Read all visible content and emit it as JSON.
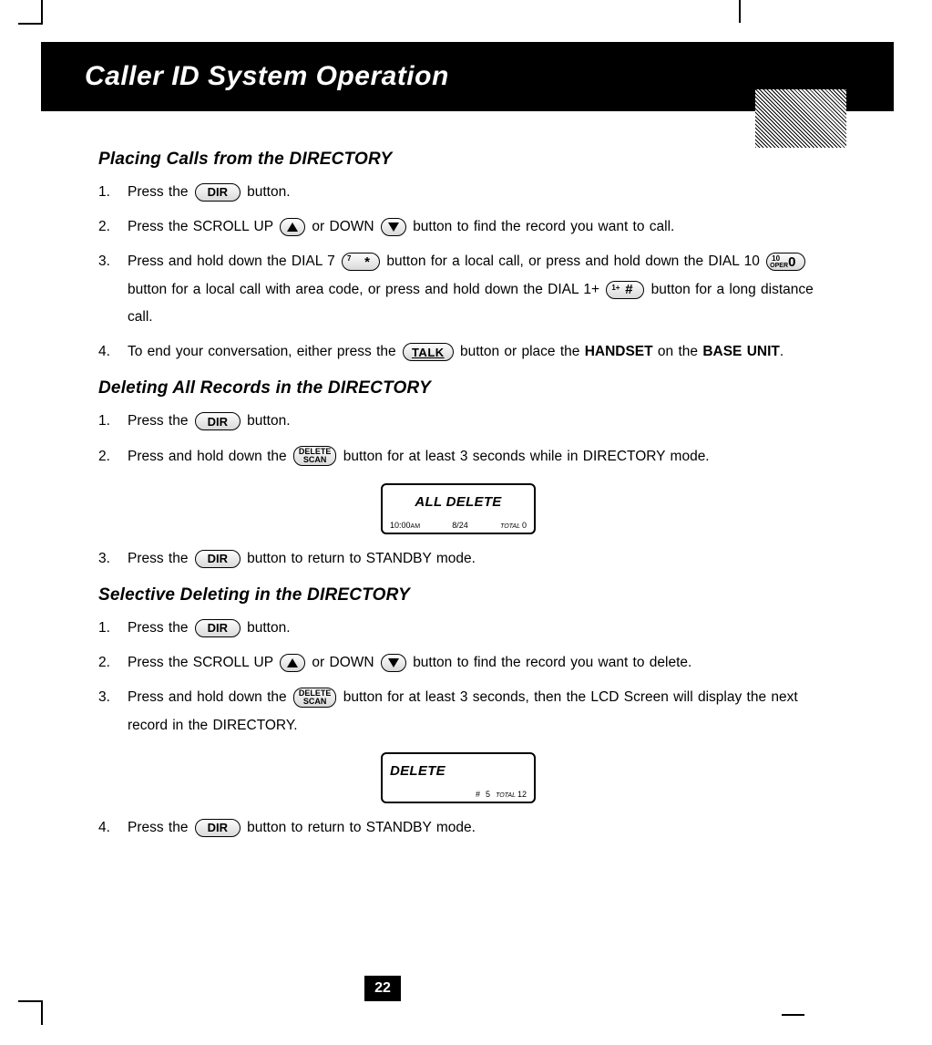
{
  "header": {
    "title": "Caller ID System Operation"
  },
  "buttons": {
    "dir": "DIR",
    "talk": "TALK",
    "delete_scan_top": "DELETE",
    "delete_scan_bot": "SCAN",
    "dial7_sup": "7",
    "dial7_main": "*",
    "dial10_sup1": "10",
    "dial10_sup2": "OPER",
    "dial10_main": "0",
    "dial1p_sup": "1+",
    "dial1p_main": "#"
  },
  "sections": {
    "s1": {
      "title": "Placing Calls from the DIRECTORY",
      "steps": {
        "n1": "1.",
        "t1a": "Press the ",
        "t1b": " button.",
        "n2": "2.",
        "t2a": "Press the SCROLL UP ",
        "t2b": " or DOWN ",
        "t2c": " button to find the record you want to call.",
        "n3": "3.",
        "t3a": "Press and hold down the DIAL 7 ",
        "t3b": " button for a local call, or press and hold down the DIAL 10 ",
        "t3c": " button for a local call with area code, or press and hold down the DIAL 1+ ",
        "t3d": " button for a long distance call.",
        "n4": "4.",
        "t4a": "To end your conversation, either press the ",
        "t4b": " button or place the ",
        "t4c": "HANDSET",
        "t4d": " on the ",
        "t4e": "BASE UNIT",
        "t4f": "."
      }
    },
    "s2": {
      "title": "Deleting All Records in the DIRECTORY",
      "steps": {
        "n1": "1.",
        "t1a": "Press the ",
        "t1b": " button.",
        "n2": "2.",
        "t2a": "Press and hold down the ",
        "t2b": " button for at least 3 seconds while in DIRECTORY mode.",
        "n3": "3.",
        "t3a": "Press the ",
        "t3b": " button to return to STANDBY mode."
      }
    },
    "s3": {
      "title": "Selective Deleting in the DIRECTORY",
      "steps": {
        "n1": "1.",
        "t1a": "Press the ",
        "t1b": " button.",
        "n2": "2.",
        "t2a": "Press the SCROLL UP ",
        "t2b": " or DOWN ",
        "t2c": " button to find the record you want to delete.",
        "n3": "3.",
        "t3a": "Press and hold down the ",
        "t3b": " button for at least 3 seconds, then the LCD Screen will display the next record in the DIRECTORY.",
        "n4": "4.",
        "t4a": "Press the ",
        "t4b": " button to return to STANDBY mode."
      }
    }
  },
  "lcd1": {
    "main": "ALL DELETE",
    "time": "10:00",
    "time_suffix": "AM",
    "date": "8/24",
    "total_label": "TOTAL",
    "total_value": "0"
  },
  "lcd2": {
    "main": "DELETE",
    "hash": "#",
    "hash_val": "5",
    "total_label": "TOTAL",
    "total_value": "12"
  },
  "page_number": "22"
}
